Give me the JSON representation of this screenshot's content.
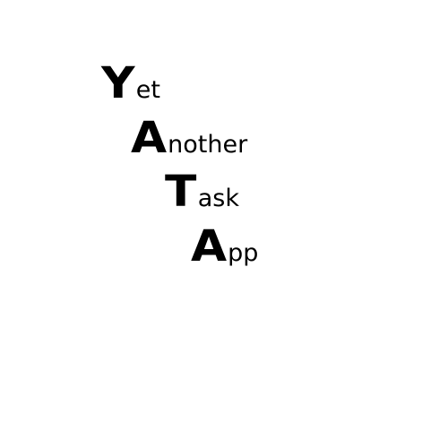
{
  "logo": {
    "lines": [
      {
        "initial": "Y",
        "rest": "et"
      },
      {
        "initial": "A",
        "rest": "nother"
      },
      {
        "initial": "T",
        "rest": "ask"
      },
      {
        "initial": "A",
        "rest": "pp"
      }
    ]
  }
}
